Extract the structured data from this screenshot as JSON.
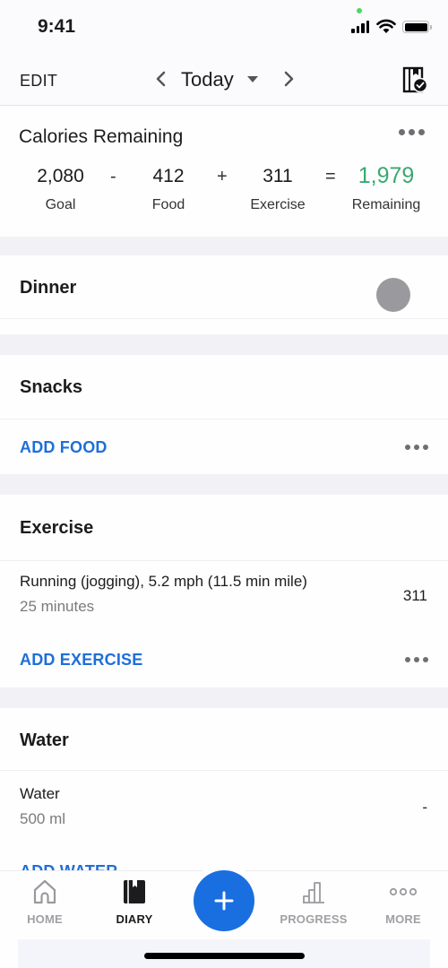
{
  "status_bar": {
    "time": "9:41"
  },
  "nav": {
    "edit_label": "EDIT",
    "date_label": "Today",
    "icons": {
      "prev": "chevron-left-icon",
      "next": "chevron-right-icon",
      "dropdown": "caret-down-icon",
      "log_complete": "diary-check-icon"
    }
  },
  "calories": {
    "title": "Calories Remaining",
    "goal": {
      "value": "2,080",
      "label": "Goal"
    },
    "op_minus": "-",
    "food": {
      "value": "412",
      "label": "Food"
    },
    "op_plus": "+",
    "exercise": {
      "value": "311",
      "label": "Exercise"
    },
    "op_equals": "=",
    "remaining": {
      "value": "1,979",
      "label": "Remaining"
    },
    "colors": {
      "remaining": "#3aa870"
    }
  },
  "sections": {
    "dinner": {
      "title": "Dinner"
    },
    "snacks": {
      "title": "Snacks",
      "add_label": "ADD FOOD"
    },
    "exercise": {
      "title": "Exercise",
      "entries": [
        {
          "name": "Running (jogging), 5.2 mph (11.5 min mile)",
          "detail": "25 minutes",
          "value": "311"
        }
      ],
      "add_label": "ADD EXERCISE"
    },
    "water": {
      "title": "Water",
      "entries": [
        {
          "name": "Water",
          "detail": "500 ml",
          "value": "-"
        }
      ],
      "add_label": "ADD WATER"
    }
  },
  "tab_bar": {
    "tabs": [
      {
        "label": "HOME",
        "icon": "home-icon",
        "active": false
      },
      {
        "label": "DIARY",
        "icon": "diary-icon",
        "active": true
      },
      {
        "label": "PROGRESS",
        "icon": "progress-chart-icon",
        "active": false
      },
      {
        "label": "MORE",
        "icon": "more-dots-icon",
        "active": false
      }
    ],
    "fab_icon": "plus-icon",
    "colors": {
      "accent": "#1a6fe0"
    }
  }
}
